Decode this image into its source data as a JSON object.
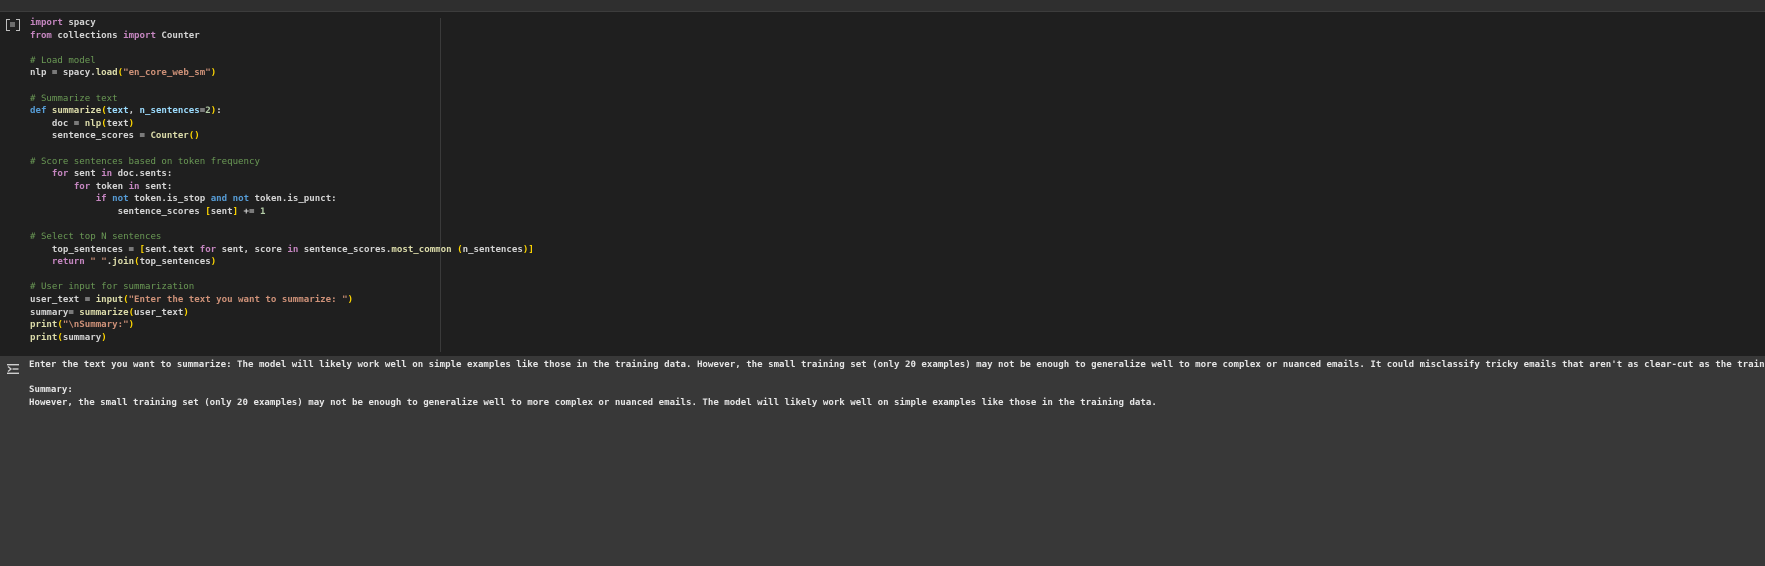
{
  "cell": {
    "run_icon": "run-cell-icon",
    "code_lines": [
      [
        [
          "kw",
          "import"
        ],
        [
          "pl",
          " spacy"
        ]
      ],
      [
        [
          "kw",
          "from"
        ],
        [
          "pl",
          " collections "
        ],
        [
          "kw",
          "import"
        ],
        [
          "pl",
          " Counter"
        ]
      ],
      [],
      [
        [
          "cm",
          "# Load model"
        ]
      ],
      [
        [
          "pl",
          "nlp = spacy."
        ],
        [
          "fn",
          "load"
        ],
        [
          "br",
          "("
        ],
        [
          "str",
          "\"en_core_web_sm\""
        ],
        [
          "br",
          ")"
        ]
      ],
      [],
      [
        [
          "cm",
          "# Summarize text"
        ]
      ],
      [
        [
          "kw2",
          "def "
        ],
        [
          "fn",
          "summarize"
        ],
        [
          "br",
          "("
        ],
        [
          "var",
          "text"
        ],
        [
          "pl",
          ", "
        ],
        [
          "var",
          "n_sentences"
        ],
        [
          "pl",
          "="
        ],
        [
          "num",
          "2"
        ],
        [
          "br",
          ")"
        ],
        [
          "pl",
          ":"
        ]
      ],
      [
        [
          "pl",
          "    doc = "
        ],
        [
          "fn",
          "nlp"
        ],
        [
          "br",
          "("
        ],
        [
          "pl",
          "text"
        ],
        [
          "br",
          ")"
        ]
      ],
      [
        [
          "pl",
          "    sentence_scores = "
        ],
        [
          "fn",
          "Counter"
        ],
        [
          "br",
          "()"
        ]
      ],
      [],
      [
        [
          "cm",
          "# Score sentences based on token frequency"
        ]
      ],
      [
        [
          "pl",
          "    "
        ],
        [
          "kw",
          "for"
        ],
        [
          "pl",
          " sent "
        ],
        [
          "kw",
          "in"
        ],
        [
          "pl",
          " doc.sents:"
        ]
      ],
      [
        [
          "pl",
          "        "
        ],
        [
          "kw",
          "for"
        ],
        [
          "pl",
          " token "
        ],
        [
          "kw",
          "in"
        ],
        [
          "pl",
          " sent:"
        ]
      ],
      [
        [
          "pl",
          "            "
        ],
        [
          "kw",
          "if"
        ],
        [
          "pl",
          " "
        ],
        [
          "kw2",
          "not"
        ],
        [
          "pl",
          " token.is_stop "
        ],
        [
          "kw2",
          "and"
        ],
        [
          "pl",
          " "
        ],
        [
          "kw2",
          "not"
        ],
        [
          "pl",
          " token.is_punct:"
        ]
      ],
      [
        [
          "pl",
          "                sentence_scores "
        ],
        [
          "br",
          "["
        ],
        [
          "pl",
          "sent"
        ],
        [
          "br",
          "]"
        ],
        [
          "pl",
          " += "
        ],
        [
          "num",
          "1"
        ]
      ],
      [],
      [
        [
          "cm",
          "# Select top N sentences"
        ]
      ],
      [
        [
          "pl",
          "    top_sentences = "
        ],
        [
          "br",
          "["
        ],
        [
          "pl",
          "sent.text "
        ],
        [
          "kw",
          "for"
        ],
        [
          "pl",
          " sent, score "
        ],
        [
          "kw",
          "in"
        ],
        [
          "pl",
          " sentence_scores."
        ],
        [
          "fn",
          "most_common"
        ],
        [
          "pl",
          " "
        ],
        [
          "br",
          "("
        ],
        [
          "pl",
          "n_sentences"
        ],
        [
          "br",
          ")"
        ],
        [
          "br",
          "]"
        ]
      ],
      [
        [
          "pl",
          "    "
        ],
        [
          "kw",
          "return"
        ],
        [
          "pl",
          " "
        ],
        [
          "str",
          "\" \""
        ],
        [
          "pl",
          "."
        ],
        [
          "fn",
          "join"
        ],
        [
          "br",
          "("
        ],
        [
          "pl",
          "top_sentences"
        ],
        [
          "br",
          ")"
        ]
      ],
      [],
      [
        [
          "cm",
          "# User input for summarization"
        ]
      ],
      [
        [
          "pl",
          "user_text = "
        ],
        [
          "fn",
          "input"
        ],
        [
          "br",
          "("
        ],
        [
          "str",
          "\"Enter the text you want to summarize: \""
        ],
        [
          "br",
          ")"
        ]
      ],
      [
        [
          "pl",
          "summary= "
        ],
        [
          "fn",
          "summarize"
        ],
        [
          "br",
          "("
        ],
        [
          "pl",
          "user_text"
        ],
        [
          "br",
          ")"
        ]
      ],
      [
        [
          "fn",
          "print"
        ],
        [
          "br",
          "("
        ],
        [
          "str",
          "\"\\nSummary:\""
        ],
        [
          "br",
          ")"
        ]
      ],
      [
        [
          "fn",
          "print"
        ],
        [
          "br",
          "("
        ],
        [
          "pl",
          "summary"
        ],
        [
          "br",
          ")"
        ]
      ]
    ]
  },
  "output": {
    "icon": "output-toggle-icon",
    "lines": [
      "Enter the text you want to summarize: The model will likely work well on simple examples like those in the training data. However, the small training set (only 20 examples) may not be enough to generalize well to more complex or nuanced emails. It could misclassify tricky emails that aren't as clear-cut as the training examples.",
      "",
      "Summary:",
      "However, the small training set (only 20 examples) may not be enough to generalize well to more complex or nuanced emails. The model will likely work well on simple examples like those in the training data."
    ]
  }
}
